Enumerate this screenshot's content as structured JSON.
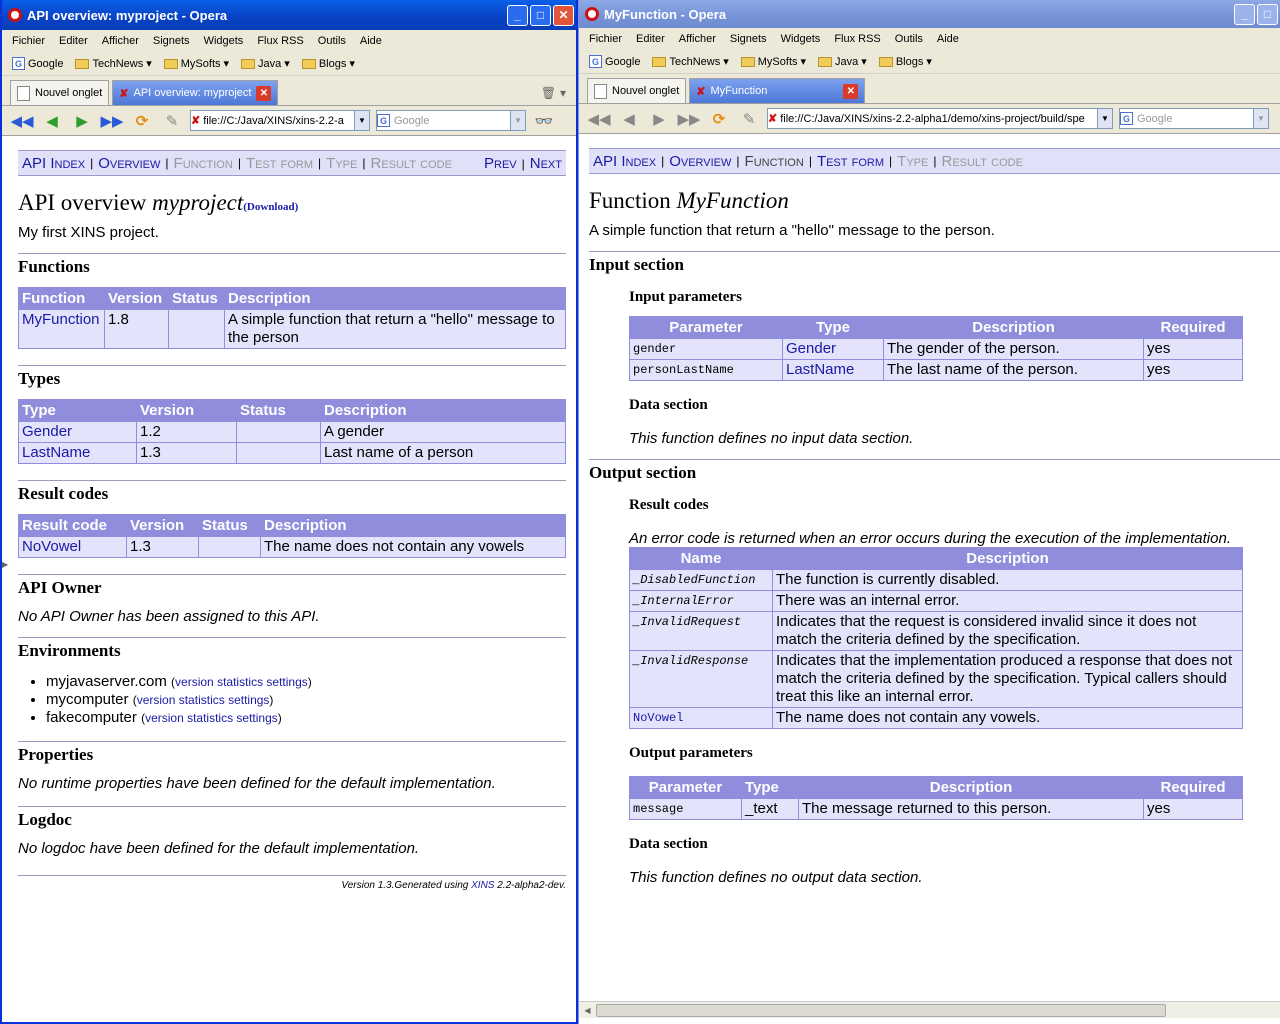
{
  "left": {
    "title": "API overview: myproject - Opera",
    "menu": [
      "Fichier",
      "Editer",
      "Afficher",
      "Signets",
      "Widgets",
      "Flux RSS",
      "Outils",
      "Aide"
    ],
    "bookmarks": [
      "Google",
      "TechNews",
      "MySofts",
      "Java",
      "Blogs"
    ],
    "tabs": [
      "Nouvel onglet",
      "API overview: myproject"
    ],
    "address": "file://C:/Java/XINS/xins-2.2-a",
    "search_placeholder": "Google",
    "nav": {
      "api_index": "API Index",
      "overview": "Overview",
      "function": "Function",
      "test_form": "Test form",
      "type": "Type",
      "result_code": "Result code",
      "prev": "Prev",
      "next": "Next"
    },
    "heading_prefix": "API overview",
    "heading_name": "myproject",
    "download": "(Download)",
    "intro": "My first XINS project.",
    "functions": {
      "title": "Functions",
      "headers": [
        "Function",
        "Version",
        "Status",
        "Description"
      ],
      "rows": [
        [
          "MyFunction",
          "1.8",
          "",
          "A simple function that return a \"hello\" message to the person"
        ]
      ]
    },
    "types": {
      "title": "Types",
      "headers": [
        "Type",
        "Version",
        "Status",
        "Description"
      ],
      "rows": [
        [
          "Gender",
          "1.2",
          "",
          "A gender"
        ],
        [
          "LastName",
          "1.3",
          "",
          "Last name of a person"
        ]
      ]
    },
    "result_codes": {
      "title": "Result codes",
      "headers": [
        "Result code",
        "Version",
        "Status",
        "Description"
      ],
      "rows": [
        [
          "NoVowel",
          "1.3",
          "",
          "The name does not contain any vowels"
        ]
      ]
    },
    "api_owner": {
      "title": "API Owner",
      "text": "No API Owner has been assigned to this API."
    },
    "environments": {
      "title": "Environments",
      "items": [
        {
          "name": "myjavaserver.com",
          "links": "version statistics settings"
        },
        {
          "name": "mycomputer",
          "links": "version statistics settings"
        },
        {
          "name": "fakecomputer",
          "links": "version statistics settings"
        }
      ]
    },
    "properties": {
      "title": "Properties",
      "text": "No runtime properties have been defined for the default implementation."
    },
    "logdoc": {
      "title": "Logdoc",
      "text": "No logdoc have been defined for the default implementation."
    },
    "footer": {
      "prefix": "Version 1.3.Generated using ",
      "link": "XINS",
      "suffix": " 2.2-alpha2-dev."
    }
  },
  "right": {
    "title": "MyFunction - Opera",
    "menu": [
      "Fichier",
      "Editer",
      "Afficher",
      "Signets",
      "Widgets",
      "Flux RSS",
      "Outils",
      "Aide"
    ],
    "bookmarks": [
      "Google",
      "TechNews",
      "MySofts",
      "Java",
      "Blogs"
    ],
    "tabs": [
      "Nouvel onglet",
      "MyFunction"
    ],
    "address": "file://C:/Java/XINS/xins-2.2-alpha1/demo/xins-project/build/spe",
    "search_placeholder": "Google",
    "nav": {
      "api_index": "API Index",
      "overview": "Overview",
      "function": "Function",
      "test_form": "Test form",
      "type": "Type",
      "result_code": "Result code"
    },
    "heading_prefix": "Function",
    "heading_name": "MyFunction",
    "intro": "A simple function that return a \"hello\" message to the person.",
    "input_section": "Input section",
    "input_params": {
      "title": "Input parameters",
      "headers": [
        "Parameter",
        "Type",
        "Description",
        "Required"
      ],
      "rows": [
        [
          "gender",
          "Gender",
          "The gender of the person.",
          "yes"
        ],
        [
          "personLastName",
          "LastName",
          "The last name of the person.",
          "yes"
        ]
      ]
    },
    "input_data": {
      "title": "Data section",
      "text": "This function defines no input data section."
    },
    "output_section": "Output section",
    "result_codes": {
      "title": "Result codes",
      "text": "An error code is returned when an error occurs during the execution of the implementation.",
      "headers": [
        "Name",
        "Description"
      ],
      "rows": [
        [
          "_DisabledFunction",
          "The function is currently disabled."
        ],
        [
          "_InternalError",
          "There was an internal error."
        ],
        [
          "_InvalidRequest",
          "Indicates that the request is considered invalid since it does not match the criteria defined by the specification."
        ],
        [
          "_InvalidResponse",
          "Indicates that the implementation produced a response that does not match the criteria defined by the specification. Typical callers should treat this like an internal error."
        ],
        [
          "NoVowel",
          "The name does not contain any vowels."
        ]
      ]
    },
    "output_params": {
      "title": "Output parameters",
      "headers": [
        "Parameter",
        "Type",
        "Description",
        "Required"
      ],
      "rows": [
        [
          "message",
          "_text",
          "The message returned to this person.",
          "yes"
        ]
      ]
    },
    "output_data": {
      "title": "Data section",
      "text": "This function defines no output data section."
    }
  }
}
